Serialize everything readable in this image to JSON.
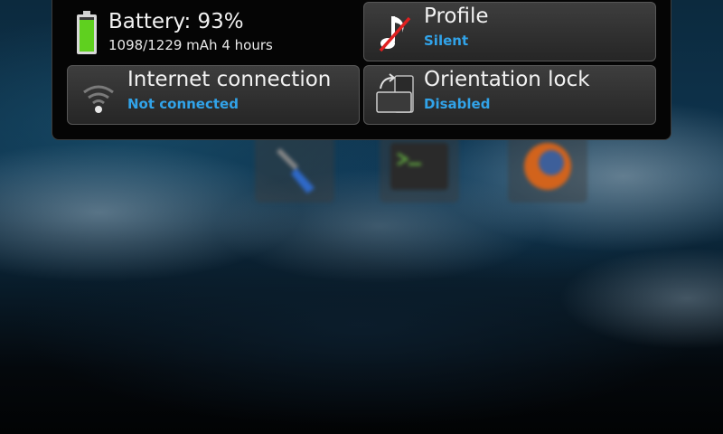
{
  "battery": {
    "title": "Battery: 93%",
    "detail": "1098/1229 mAh  4 hours",
    "level": 0.93,
    "icon": "battery-icon"
  },
  "profile": {
    "title": "Profile",
    "value": "Silent",
    "icon": "music-note-muted-icon"
  },
  "internet": {
    "title": "Internet connection",
    "value": "Not connected",
    "icon": "wifi-icon"
  },
  "orientation": {
    "title": "Orientation lock",
    "value": "Disabled",
    "icon": "rotate-screen-icon"
  },
  "colors": {
    "accent": "#31a3e9",
    "battery_green": "#5fd01f",
    "mute_red": "#e02020"
  },
  "desktop_icons": [
    "settings-wrench-icon",
    "terminal-icon",
    "firefox-icon"
  ]
}
